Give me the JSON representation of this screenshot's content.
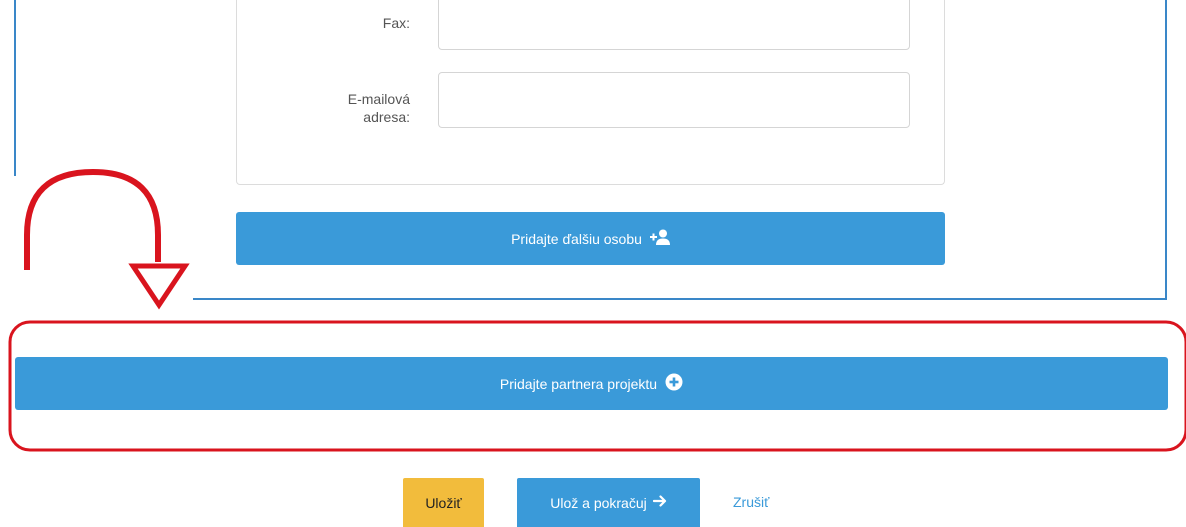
{
  "form": {
    "fax_label": "Fax:",
    "email_label_line1": "E-mailová",
    "email_label_line2": "adresa:",
    "fax_value": "",
    "email_value": ""
  },
  "buttons": {
    "add_person": "Pridajte ďalšiu osobu",
    "add_partner": "Pridajte partnera projektu",
    "save": "Uložiť",
    "save_continue": "Ulož a pokračuj",
    "cancel": "Zrušiť"
  },
  "icons": {
    "add_person": "user-plus-icon",
    "add_partner": "plus-circle-icon",
    "save_continue": "arrow-right-icon"
  },
  "colors": {
    "primary": "#3a9ad9",
    "frame": "#3a87c8",
    "save": "#f2bc3c",
    "annotation": "#d9141e"
  }
}
